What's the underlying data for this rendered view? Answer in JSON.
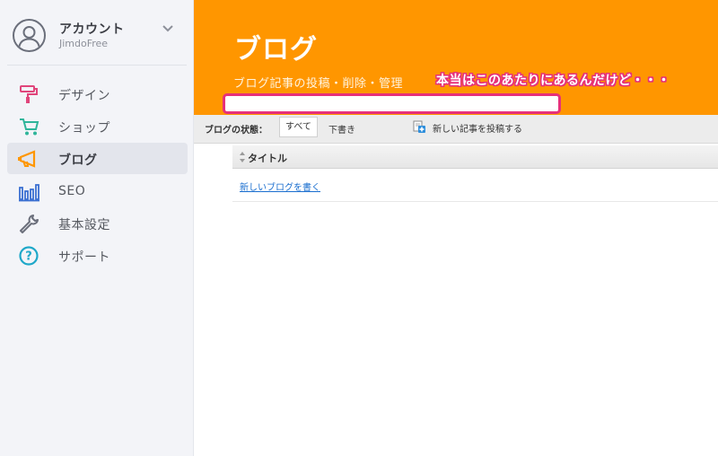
{
  "account": {
    "name": "アカウント",
    "plan": "JimdoFree"
  },
  "sidebar": {
    "items": [
      {
        "label": "デザイン",
        "icon": "paint-roller-icon",
        "color": "#e0457b"
      },
      {
        "label": "ショップ",
        "icon": "cart-icon",
        "color": "#2fb59a"
      },
      {
        "label": "ブログ",
        "icon": "megaphone-icon",
        "color": "#ff9600",
        "active": true
      },
      {
        "label": "SEO",
        "icon": "bar-chart-icon",
        "color": "#3a6fd1"
      },
      {
        "label": "基本設定",
        "icon": "wrench-icon",
        "color": "#6b6f7b"
      },
      {
        "label": "サポート",
        "icon": "help-circle-icon",
        "color": "#1fa8c9"
      }
    ]
  },
  "header": {
    "title": "ブログ",
    "subtitle": "ブログ記事の投稿・削除・管理",
    "annotation": "本当はこのあたりにあるんだけど・・・",
    "background": "#ff9600",
    "highlight_color": "#e6307a"
  },
  "toolbar": {
    "status_label": "ブログの状態：",
    "filter_all": "すべて",
    "filter_draft": "下書き",
    "new_post_label": "新しい記事を投稿する"
  },
  "table": {
    "column_title": "タイトル",
    "new_blog_link": "新しいブログを書く"
  }
}
